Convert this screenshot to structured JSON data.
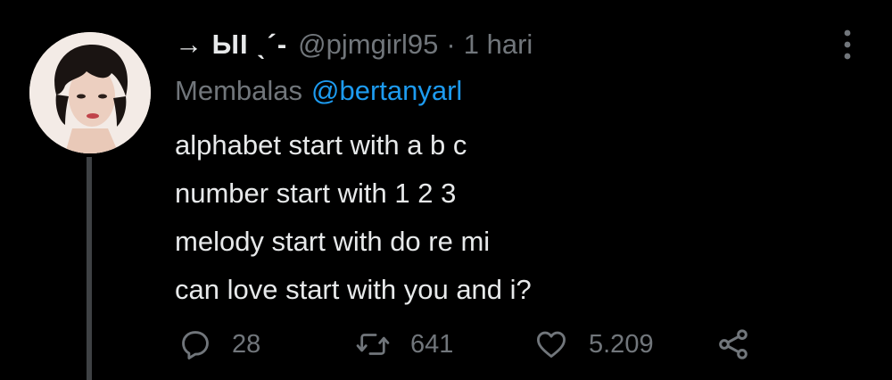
{
  "tweet": {
    "display_name": "→ ЫI ˎ´-",
    "handle": "@pjmgirl95",
    "separator": "·",
    "timestamp": "1 hari",
    "reply_prefix": "Membalas",
    "reply_to": "@bertanyarl",
    "text_lines": [
      "alphabet start with a b c",
      "number start with 1 2 3",
      "melody start with do re mi",
      "can love start with you and i?"
    ],
    "actions": {
      "reply": {
        "icon": "reply-icon",
        "count": "28"
      },
      "retweet": {
        "icon": "retweet-icon",
        "count": "641"
      },
      "like": {
        "icon": "heart-icon",
        "count": "5.209"
      },
      "share": {
        "icon": "share-icon"
      }
    },
    "more_icon": "more-vertical-icon"
  },
  "colors": {
    "background": "#000000",
    "text_primary": "#e7e9ea",
    "text_secondary": "#71767b",
    "link": "#1d9bf0",
    "thread_line": "#3e4144"
  }
}
